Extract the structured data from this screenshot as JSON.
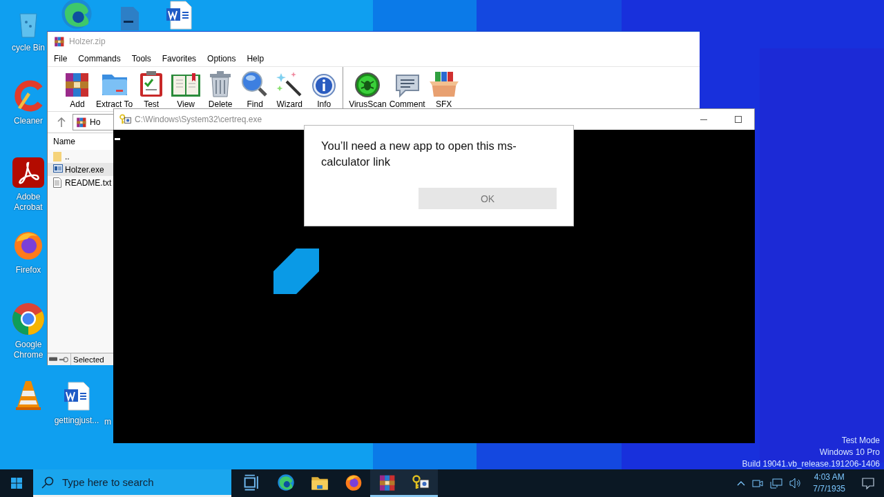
{
  "desktop_icons": [
    {
      "kind": "recycle",
      "label": "cycle Bin"
    },
    {
      "kind": "edge"
    },
    {
      "kind": "file"
    },
    {
      "kind": "word"
    },
    {
      "kind": "ccleaner",
      "label": "Cleaner"
    },
    {
      "kind": "acrobat",
      "label": "Adobe Acrobat"
    },
    {
      "kind": "firefox",
      "label": "Firefox"
    },
    {
      "kind": "chrome",
      "label": "Google Chrome"
    },
    {
      "kind": "vlc"
    },
    {
      "kind": "word",
      "label": "gettingjust..."
    },
    {
      "kind": "none",
      "label": "m"
    }
  ],
  "winrar": {
    "title": "Holzer.zip",
    "menu": [
      "File",
      "Commands",
      "Tools",
      "Favorites",
      "Options",
      "Help"
    ],
    "toolbar": [
      [
        {
          "kind": "archive",
          "label": "Add"
        },
        {
          "kind": "folder",
          "label": "Extract To"
        },
        {
          "kind": "clipboard",
          "label": "Test"
        },
        {
          "kind": "book",
          "label": "View"
        },
        {
          "kind": "trash",
          "label": "Delete"
        },
        {
          "kind": "magnifier",
          "label": "Find"
        },
        {
          "kind": "wand",
          "label": "Wizard"
        },
        {
          "kind": "info",
          "label": "Info"
        }
      ],
      [
        {
          "kind": "bug",
          "label": "VirusScan"
        },
        {
          "kind": "speech",
          "label": "Comment"
        },
        {
          "kind": "box",
          "label": "SFX"
        }
      ]
    ],
    "path": "Ho",
    "column": "Name",
    "files": [
      {
        "kind": "folder",
        "name": "..",
        "selected": false
      },
      {
        "kind": "exe",
        "name": "Holzer.exe",
        "selected": true
      },
      {
        "kind": "text",
        "name": "README.txt",
        "selected": false
      }
    ],
    "status": "Selected"
  },
  "console": {
    "title": "C:\\Windows\\System32\\certreq.exe"
  },
  "dialog": {
    "message": "You’ll need a new app to open this ms-calculator link",
    "button": "OK"
  },
  "system_watermark": [
    "Test Mode",
    "Windows 10 Pro",
    "Build 19041.vb_release.191206-1406"
  ],
  "taskbar": {
    "search_placeholder": "Type here to search",
    "apps": [
      {
        "kind": "task-view",
        "active": false
      },
      {
        "kind": "edge",
        "active": false
      },
      {
        "kind": "folder",
        "active": false
      },
      {
        "kind": "firefox",
        "active": false
      },
      {
        "kind": "winrar",
        "active": true
      },
      {
        "kind": "certreq",
        "active": true
      }
    ],
    "time": "4:03 AM",
    "date": "7/7/1935"
  }
}
